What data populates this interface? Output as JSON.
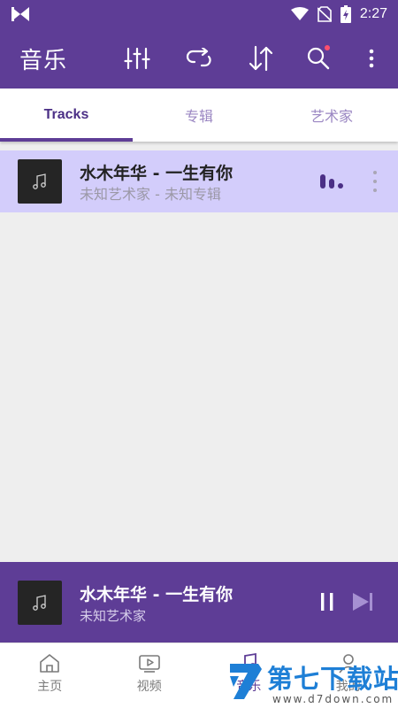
{
  "status_bar": {
    "time": "2:27"
  },
  "app_bar": {
    "title": "音乐",
    "actions": [
      "equalizer-icon",
      "repeat-icon",
      "sort-icon",
      "search-icon",
      "more-vert-icon"
    ]
  },
  "tabs": [
    {
      "label": "Tracks",
      "active": true
    },
    {
      "label": "专辑",
      "active": false
    },
    {
      "label": "艺术家",
      "active": false
    }
  ],
  "tracks": [
    {
      "title": "水木年华 - 一生有你",
      "subtitle": "未知艺术家 - 未知专辑",
      "playing": true
    }
  ],
  "mini_player": {
    "title": "水木年华 - 一生有你",
    "artist": "未知艺术家"
  },
  "bottom_nav": [
    {
      "label": "主页",
      "icon": "home-icon"
    },
    {
      "label": "视频",
      "icon": "video-icon"
    },
    {
      "label": "音乐",
      "icon": "music-icon",
      "active": true
    },
    {
      "label": "我的",
      "icon": "profile-icon"
    }
  ],
  "watermark": {
    "text": "第七下载站",
    "url": "www.d7down.com"
  },
  "colors": {
    "primary": "#5e3d96",
    "highlight_row": "#d3cdfb",
    "badge": "#ff4f6d",
    "watermark": "#1e7fd6"
  }
}
